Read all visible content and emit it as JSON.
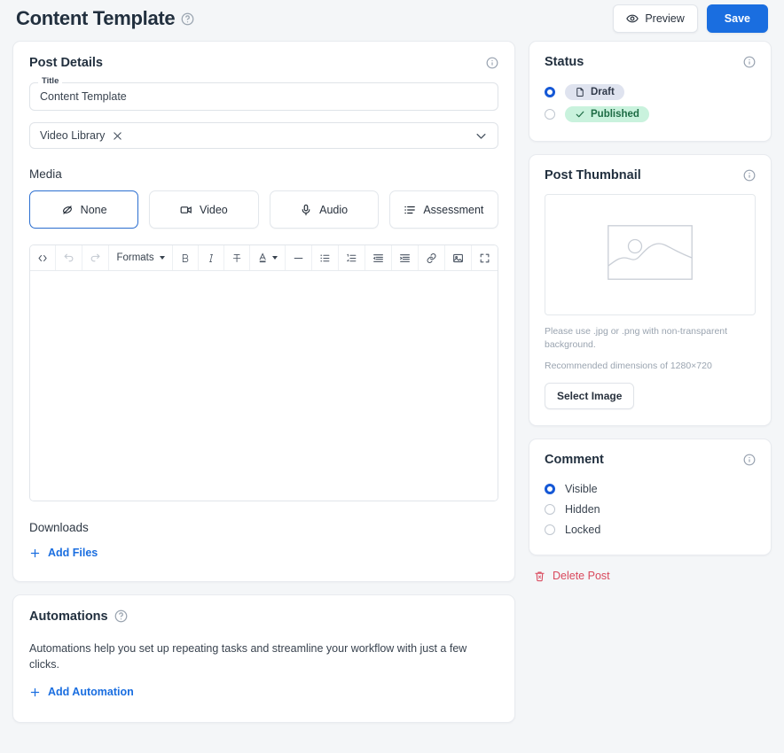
{
  "header": {
    "title": "Content Template",
    "help_icon": "question-circle-icon",
    "preview_label": "Preview",
    "save_label": "Save",
    "accent_color": "#1a6ee0"
  },
  "post_details": {
    "heading": "Post Details",
    "info_icon": "info-circle-icon",
    "title_field": {
      "legend": "Title",
      "value": "Content Template",
      "placeholder": "Title"
    },
    "library_select": {
      "chip_label": "Video Library",
      "remove_icon": "close-x-icon",
      "chevron_icon": "chevron-down-icon"
    },
    "media_label": "Media",
    "media_options": [
      {
        "label": "None",
        "icon": "eye-off-icon",
        "selected": true
      },
      {
        "label": "Video",
        "icon": "video-camera-icon",
        "selected": false
      },
      {
        "label": "Audio",
        "icon": "microphone-icon",
        "selected": false
      },
      {
        "label": "Assessment",
        "icon": "list-checks-icon",
        "selected": false
      }
    ],
    "editor_toolbar": [
      {
        "name": "source-code-icon",
        "glyph": "</>",
        "disabled": false
      },
      {
        "name": "undo-icon",
        "glyph": "↶",
        "disabled": true
      },
      {
        "name": "redo-icon",
        "glyph": "↷",
        "disabled": true
      },
      {
        "name": "formats-dropdown",
        "glyph": "Formats",
        "disabled": false
      },
      {
        "name": "bold-icon",
        "glyph": "B",
        "disabled": false
      },
      {
        "name": "italic-icon",
        "glyph": "I",
        "disabled": false
      },
      {
        "name": "strikethrough-icon",
        "glyph": "S",
        "disabled": false
      },
      {
        "name": "text-color-icon",
        "glyph": "A",
        "disabled": false
      },
      {
        "name": "horizontal-rule-icon",
        "glyph": "—",
        "disabled": false
      },
      {
        "name": "bullet-list-icon",
        "glyph": "•≡",
        "disabled": false
      },
      {
        "name": "numbered-list-icon",
        "glyph": "1≡",
        "disabled": false
      },
      {
        "name": "outdent-icon",
        "glyph": "⇤",
        "disabled": false
      },
      {
        "name": "indent-icon",
        "glyph": "⇥",
        "disabled": false
      },
      {
        "name": "link-icon",
        "glyph": "🔗",
        "disabled": false
      },
      {
        "name": "image-icon",
        "glyph": "🖼",
        "disabled": false
      },
      {
        "name": "fullscreen-icon",
        "glyph": "⛶",
        "disabled": false
      }
    ],
    "formats_label": "Formats",
    "editor_content": "",
    "downloads_label": "Downloads",
    "add_files_label": "Add Files"
  },
  "automations": {
    "heading": "Automations",
    "help_icon": "question-circle-icon",
    "description": "Automations help you set up repeating tasks and streamline your workflow with just a few clicks.",
    "add_label": "Add Automation"
  },
  "status": {
    "heading": "Status",
    "info_icon": "info-circle-icon",
    "options": [
      {
        "label": "Draft",
        "icon": "document-icon",
        "selected": true,
        "badge_bg": "#dfe3ef",
        "badge_fg": "#313a4a"
      },
      {
        "label": "Published",
        "icon": "check-icon",
        "selected": false,
        "badge_bg": "#c9f2dd",
        "badge_fg": "#1d6b44"
      }
    ]
  },
  "thumbnail": {
    "heading": "Post Thumbnail",
    "info_icon": "info-circle-icon",
    "placeholder_icon": "image-placeholder-icon",
    "note": "Please use .jpg or .png with non-transparent background.",
    "dimensions_note": "Recommended dimensions of 1280×720",
    "select_label": "Select Image"
  },
  "comment": {
    "heading": "Comment",
    "info_icon": "info-circle-icon",
    "options": [
      {
        "label": "Visible",
        "selected": true
      },
      {
        "label": "Hidden",
        "selected": false
      },
      {
        "label": "Locked",
        "selected": false
      }
    ]
  },
  "delete": {
    "label": "Delete Post",
    "icon": "trash-icon",
    "color": "#d9485c"
  }
}
